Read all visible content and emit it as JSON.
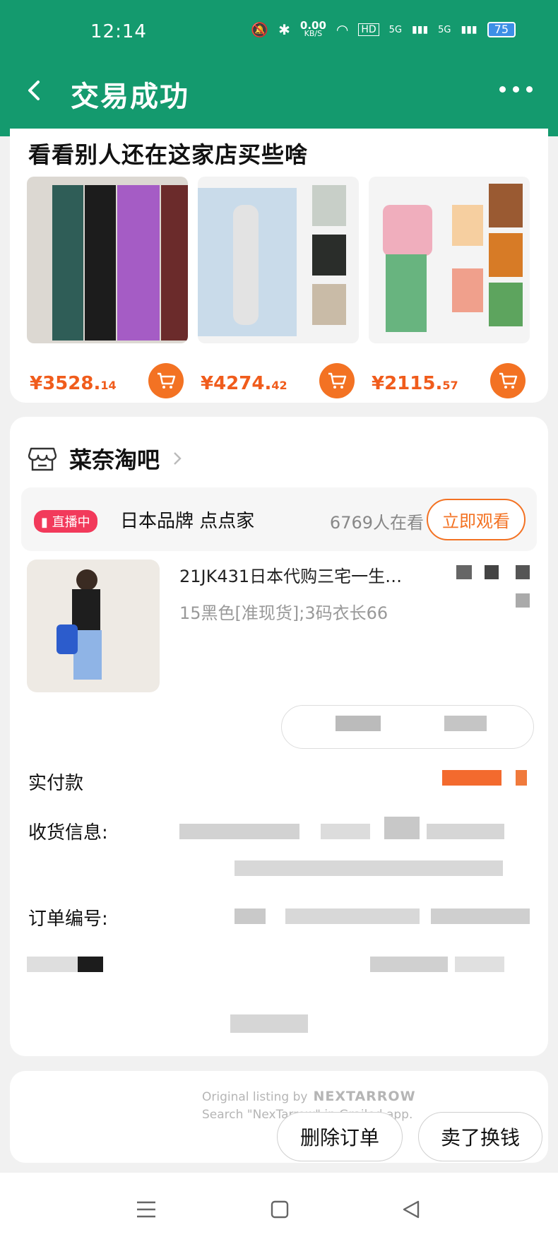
{
  "status_bar": {
    "time": "12:14",
    "net_speed": "0.00",
    "net_unit": "KB/S",
    "hd": "HD",
    "signal1": "5G",
    "signal2": "5G",
    "battery": "75"
  },
  "header": {
    "title": "交易成功"
  },
  "recommend": {
    "title": "看看别人还在这家店买些啥",
    "products": [
      {
        "price_main": "¥3528.",
        "price_cents": "14"
      },
      {
        "price_main": "¥4274.",
        "price_cents": "42"
      },
      {
        "price_main": "¥2115.",
        "price_cents": "57"
      }
    ]
  },
  "store": {
    "name": "菜奈淘吧",
    "live_badge": "直播中",
    "live_text": "日本品牌 点点家",
    "viewers": "6769人在看",
    "watch_button": "立即观看"
  },
  "item": {
    "title": "21JK431日本代购三宅一生…",
    "spec": "15黑色[准现货];3码衣长66"
  },
  "order": {
    "paid_label": "实付款",
    "shipping_label": "收货信息:",
    "order_no_label": "订单编号:"
  },
  "watermark": {
    "line1": "Original listing by",
    "brand": "NEXTARROW",
    "line2": "Search \"NexTarrow\" in Grailed app."
  },
  "bottom": {
    "delete_order": "删除订单",
    "sell_for_cash": "卖了换钱"
  },
  "colors": {
    "header": "#149a6e",
    "accent": "#f37223",
    "price": "#f05c1c",
    "live": "#f23a5b"
  }
}
